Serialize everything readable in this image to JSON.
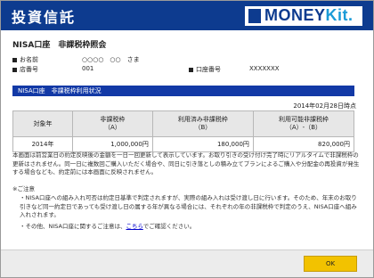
{
  "header": {
    "title": "投資信託",
    "logo_main": "MONEY",
    "logo_kit": "Kit."
  },
  "page": {
    "title": "NISA口座　非課税枠照会"
  },
  "customer": {
    "name_label": "お名前",
    "name_value": "○○○○　○○　さま",
    "branch_label": "店番号",
    "branch_value": "001",
    "account_label": "口座番号",
    "account_value": "XXXXXXX"
  },
  "status_bar": {
    "label": "NISA口座　非課税枠利用状況"
  },
  "as_of": "2014年02月28日時点",
  "table": {
    "headers": [
      [
        "対象年",
        ""
      ],
      [
        "非課税枠",
        "（A）"
      ],
      [
        "利用済み非課税枠",
        "（B）"
      ],
      [
        "利用可能非課税枠",
        "（A）-（B）"
      ]
    ],
    "rows": [
      [
        "2014年",
        "1,000,000円",
        "180,000円",
        "820,000円"
      ]
    ]
  },
  "notes": {
    "para1": "本画面は前営業日の約定反映後の金額を一日一回更新して表示しています。お取り引きの受け付け完了時にリアルタイムで非課税枠の更新はされません。同一日に複数回ご購入いただく場合や、同日に引き落としの積み立てプランによるご購入や分配金の再投資が発生する場合なども、約定前には本画面に反映されません。",
    "caution_title": "※ご注意",
    "bullet1": "・NISA口座への組み入れ可否は約定日基準で判定されますが、実際の組み入れは受け渡し日に行います。そのため、年末のお取り引きなど同一約定日であっても受け渡し日の属する年が異なる場合には、それぞれの年の非課税枠で判定のうえ、NISA口座へ組み入れされます。",
    "bullet2_pre": "・その他、NISA口座に関するご注意は、",
    "bullet2_link": "こちら",
    "bullet2_post": "でご確認ください。"
  },
  "footer": {
    "ok_label": "OK"
  }
}
